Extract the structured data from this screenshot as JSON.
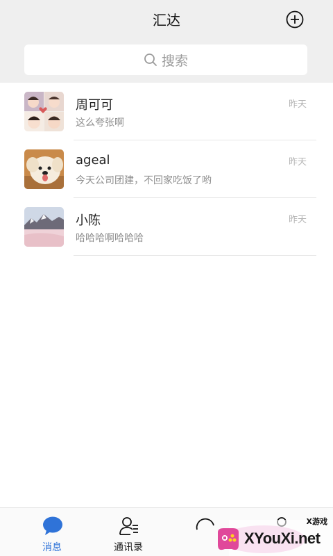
{
  "header": {
    "title": "汇达",
    "add_icon": "plus-circle-icon"
  },
  "search": {
    "icon": "search-icon",
    "placeholder": "搜索"
  },
  "conversations": [
    {
      "name": "周可可",
      "preview": "这么夸张啊",
      "time": "昨天",
      "avatar": "collage-of-baby-photos"
    },
    {
      "name": "ageal",
      "preview": "今天公司团建，不回家吃饭了哟",
      "time": "昨天",
      "avatar": "fluffy-dog-photo"
    },
    {
      "name": "小陈",
      "preview": "哈哈哈啊哈哈哈",
      "time": "昨天",
      "avatar": "snowy-mountain-photo"
    }
  ],
  "tabs": [
    {
      "label": "消息",
      "icon": "chat-bubble-icon",
      "active": true
    },
    {
      "label": "通讯录",
      "icon": "contacts-icon",
      "active": false
    },
    {
      "label": "",
      "icon": "discover-icon",
      "active": false
    },
    {
      "label": "",
      "icon": "me-icon",
      "active": false
    }
  ],
  "watermark": {
    "brand": "XYouXi.net",
    "tagline": "X游戏"
  },
  "colors": {
    "accent": "#2f73d8",
    "header_bg": "#efefef",
    "secondary_text": "#8e8e8e"
  }
}
